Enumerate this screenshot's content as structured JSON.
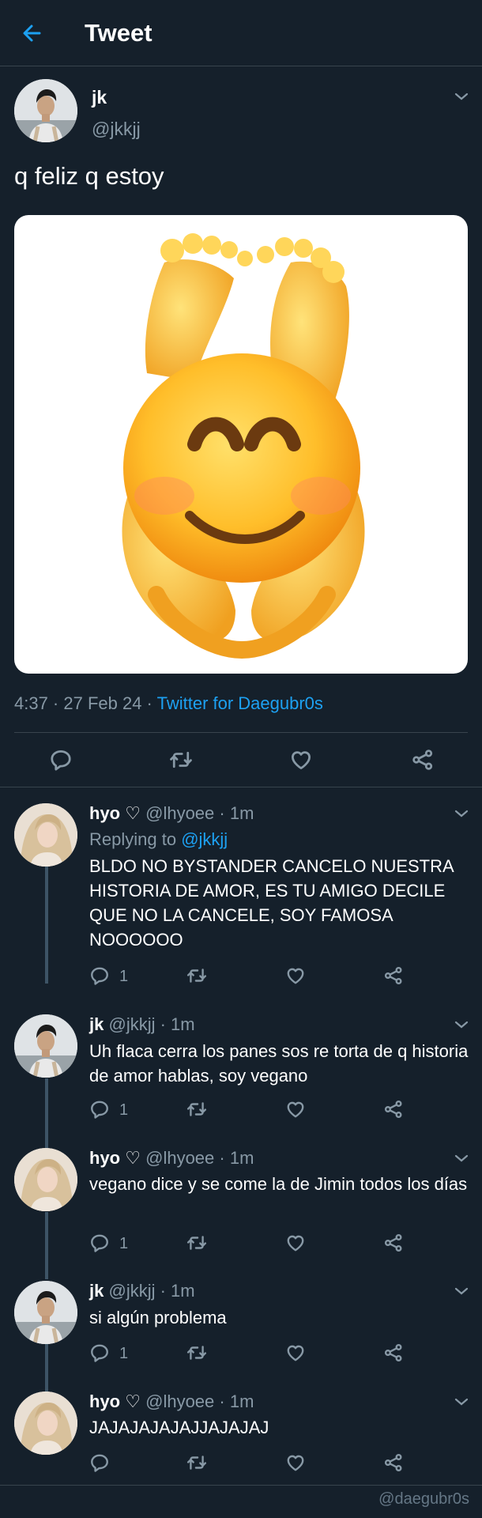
{
  "header": {
    "title": "Tweet"
  },
  "tweet": {
    "name": "jk",
    "handle": "@jkkjj",
    "text": "q feliz q estoy",
    "time": "4:37 · 27 Feb 24 · ",
    "source": "Twitter for Daegubr0s"
  },
  "replies": [
    {
      "name": "hyo",
      "heart": "♡",
      "handle": "@lhyoee",
      "time": "· 1m",
      "replying_label": "Replying to ",
      "replying_to": "@jkkjj",
      "text": "BLDO NO BYSTANDER CANCELO NUESTRA HISTORIA DE AMOR, ES TU AMIGO DECILE QUE NO LA CANCELE, SOY FAMOSA NOOOOOO",
      "reply_count": "1"
    },
    {
      "name": "jk",
      "heart": "",
      "handle": "@jkkjj",
      "time": "· 1m",
      "text": "Uh flaca cerra los panes sos re torta de q historia de amor hablas, soy vegano",
      "reply_count": "1"
    },
    {
      "name": "hyo",
      "heart": "♡",
      "handle": "@lhyoee",
      "time": "· 1m",
      "text": "vegano dice y se come la de Jimin todos los días",
      "reply_count": "1"
    },
    {
      "name": "jk",
      "heart": "",
      "handle": "@jkkjj",
      "time": "· 1m",
      "text": "si algún problema",
      "reply_count": "1"
    },
    {
      "name": "hyo",
      "heart": "♡",
      "handle": "@lhyoee",
      "time": "· 1m",
      "text": "JAJAJAJAJAJJAJAJAJ",
      "reply_count": ""
    }
  ],
  "watermark": "@daegubr0s",
  "colors": {
    "background": "#15202b",
    "accent": "#1da1f2",
    "muted": "#8899a6",
    "divider": "#38444d"
  }
}
